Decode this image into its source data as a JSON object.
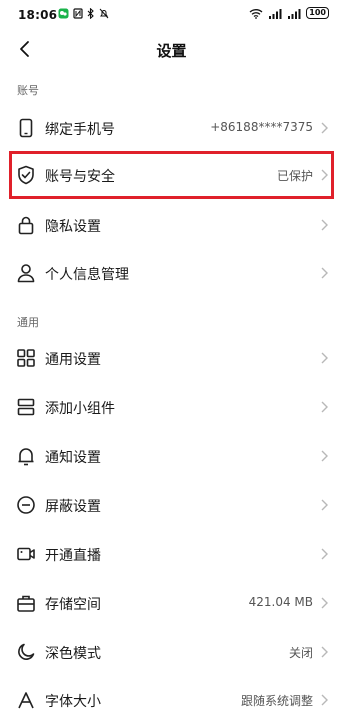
{
  "status_bar": {
    "time": "18:06",
    "battery": "100"
  },
  "nav": {
    "title": "设置"
  },
  "sections": {
    "account": "账号",
    "general": "通用"
  },
  "rows": {
    "bind_phone": {
      "label": "绑定手机号",
      "value": "+86188****7375"
    },
    "account_security": {
      "label": "账号与安全",
      "value": "已保护"
    },
    "privacy": {
      "label": "隐私设置"
    },
    "personal_info": {
      "label": "个人信息管理"
    },
    "general_settings": {
      "label": "通用设置"
    },
    "add_widget": {
      "label": "添加小组件"
    },
    "notifications": {
      "label": "通知设置"
    },
    "block": {
      "label": "屏蔽设置"
    },
    "live": {
      "label": "开通直播"
    },
    "storage": {
      "label": "存储空间",
      "value": "421.04 MB"
    },
    "dark_mode": {
      "label": "深色模式",
      "value": "关闭"
    },
    "font_size": {
      "label": "字体大小",
      "value": "跟随系统调整"
    }
  },
  "colors": {
    "highlight": "#e0202a",
    "chevron": "#b8b8b8"
  }
}
